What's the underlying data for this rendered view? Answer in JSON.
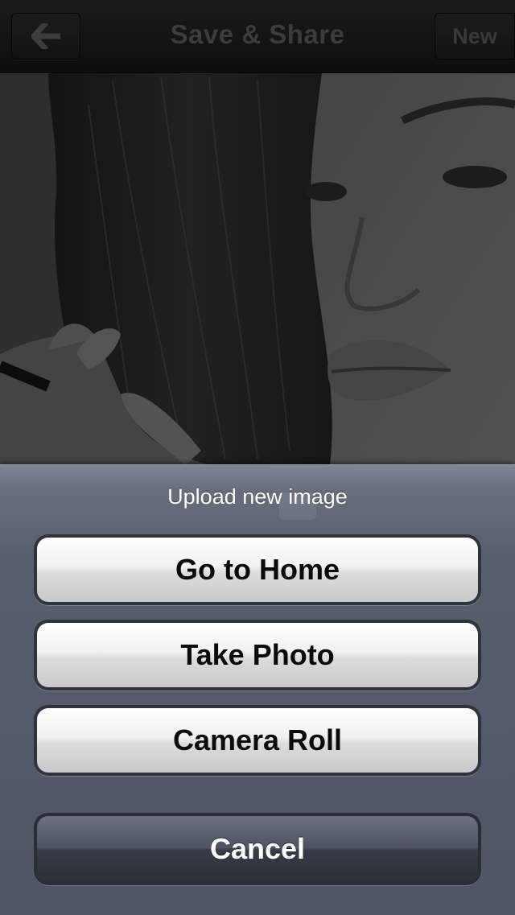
{
  "navbar": {
    "back_icon": "arrow-left-icon",
    "title": "Save & Share",
    "new_label": "New"
  },
  "photo": {
    "description_icon": "photo-preview"
  },
  "action_sheet": {
    "title": "Upload new image",
    "buttons": [
      {
        "label": "Go to Home"
      },
      {
        "label": "Take Photo"
      },
      {
        "label": "Camera Roll"
      }
    ],
    "cancel_label": "Cancel"
  },
  "colors": {
    "sheet_background": "#575e6c",
    "button_face": "#f1f1f1",
    "cancel_face": "#363b45",
    "navbar": "#121212"
  }
}
